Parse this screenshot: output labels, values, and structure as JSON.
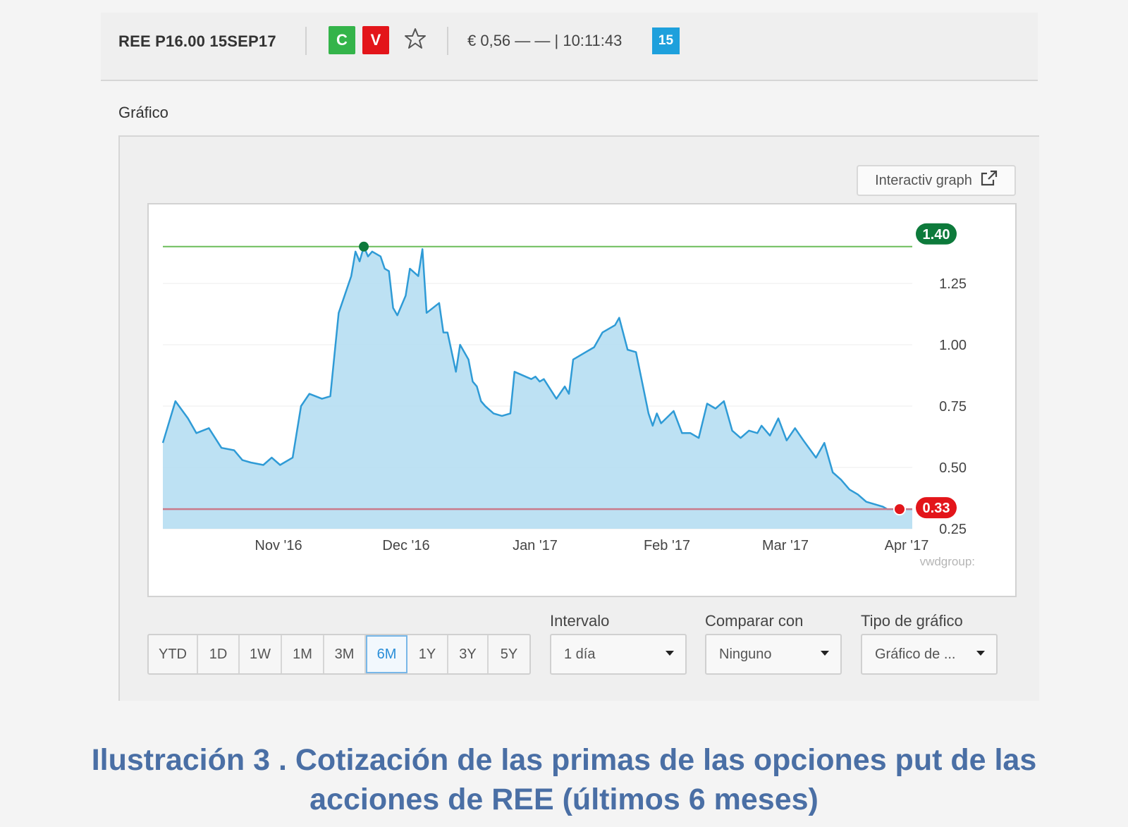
{
  "topbar": {
    "instrument": "REE P16.00 15SEP17",
    "buy_label": "C",
    "sell_label": "V",
    "quote": "€ 0,56 — — | 10:11:43",
    "delay_badge": "15",
    "icons": {
      "favorite": "star-outline-icon"
    }
  },
  "section_title": "Gráfico",
  "interactive_graph": {
    "label": "Interactiv graph",
    "icon": "external-link-icon"
  },
  "chart_data": {
    "type": "area",
    "x_ticks": [
      "Nov '16",
      "Dec '16",
      "Jan '17",
      "Feb '17",
      "Mar '17",
      "Apr '17"
    ],
    "y_ticks": [
      "1.25",
      "1.00",
      "0.75",
      "0.50",
      "0.25"
    ],
    "ylim": [
      0.25,
      1.5
    ],
    "grid": true,
    "high_label": "1.40",
    "low_label": "0.33",
    "high_value": 1.4,
    "low_value": 0.33,
    "watermark": "vwdgroup:",
    "colors": {
      "line": "#2f9bd6",
      "fill": "#b9dff2",
      "high": "#0d7a3b",
      "low": "#e3151a"
    },
    "series": [
      {
        "x": [
          "2016-10-07",
          "2016-10-10",
          "2016-10-13",
          "2016-10-15",
          "2016-10-18",
          "2016-10-21",
          "2016-10-24",
          "2016-10-26",
          "2016-10-28",
          "2016-10-31",
          "2016-11-02",
          "2016-11-04",
          "2016-11-07",
          "2016-11-09",
          "2016-11-11",
          "2016-11-14",
          "2016-11-16",
          "2016-11-18",
          "2016-11-21",
          "2016-11-22",
          "2016-11-23",
          "2016-11-24",
          "2016-11-25",
          "2016-11-26",
          "2016-11-28",
          "2016-11-29",
          "2016-11-30",
          "2016-12-01",
          "2016-12-02",
          "2016-12-04",
          "2016-12-05",
          "2016-12-07",
          "2016-12-08",
          "2016-12-09",
          "2016-12-12",
          "2016-12-13",
          "2016-12-14",
          "2016-12-16",
          "2016-12-17",
          "2016-12-19",
          "2016-12-20",
          "2016-12-21",
          "2016-12-22",
          "2016-12-23",
          "2016-12-25",
          "2016-12-27",
          "2016-12-29",
          "2016-12-30",
          "2017-01-03",
          "2017-01-04",
          "2017-01-05",
          "2017-01-06",
          "2017-01-09",
          "2017-01-11",
          "2017-01-12",
          "2017-01-13",
          "2017-01-16",
          "2017-01-18",
          "2017-01-20",
          "2017-01-23",
          "2017-01-24",
          "2017-01-26",
          "2017-01-28",
          "2017-01-31",
          "2017-02-01",
          "2017-02-02",
          "2017-02-03",
          "2017-02-06",
          "2017-02-08",
          "2017-02-10",
          "2017-02-12",
          "2017-02-14",
          "2017-02-16",
          "2017-02-18",
          "2017-02-20",
          "2017-02-22",
          "2017-02-24",
          "2017-02-26",
          "2017-02-27",
          "2017-03-01",
          "2017-03-03",
          "2017-03-05",
          "2017-03-07",
          "2017-03-09",
          "2017-03-12",
          "2017-03-14",
          "2017-03-16",
          "2017-03-18",
          "2017-03-20",
          "2017-03-22",
          "2017-03-24",
          "2017-03-26",
          "2017-03-28",
          "2017-03-29",
          "2017-03-30",
          "2017-03-31",
          "2017-04-01",
          "2017-04-03",
          "2017-04-04"
        ],
        "values": [
          0.6,
          0.77,
          0.7,
          0.64,
          0.66,
          0.58,
          0.57,
          0.53,
          0.52,
          0.51,
          0.54,
          0.51,
          0.54,
          0.75,
          0.8,
          0.78,
          0.79,
          1.13,
          1.28,
          1.38,
          1.34,
          1.4,
          1.36,
          1.38,
          1.36,
          1.31,
          1.3,
          1.15,
          1.12,
          1.2,
          1.31,
          1.28,
          1.39,
          1.13,
          1.17,
          1.05,
          1.05,
          0.89,
          1.0,
          0.94,
          0.85,
          0.83,
          0.77,
          0.75,
          0.72,
          0.71,
          0.72,
          0.89,
          0.86,
          0.87,
          0.85,
          0.86,
          0.78,
          0.83,
          0.8,
          0.94,
          0.97,
          0.99,
          1.05,
          1.08,
          1.11,
          0.98,
          0.97,
          0.72,
          0.67,
          0.72,
          0.68,
          0.73,
          0.64,
          0.64,
          0.62,
          0.76,
          0.74,
          0.77,
          0.65,
          0.62,
          0.65,
          0.64,
          0.67,
          0.63,
          0.7,
          0.61,
          0.66,
          0.61,
          0.54,
          0.6,
          0.48,
          0.45,
          0.41,
          0.39,
          0.36,
          0.35,
          0.34,
          0.33,
          0.33,
          0.33,
          0.33,
          0.33,
          0.33
        ]
      }
    ]
  },
  "ranges": [
    "YTD",
    "1D",
    "1W",
    "1M",
    "3M",
    "6M",
    "1Y",
    "3Y",
    "5Y"
  ],
  "active_range": "6M",
  "interval": {
    "label": "Intervalo",
    "value": "1 día"
  },
  "compare": {
    "label": "Comparar con",
    "value": "Ninguno"
  },
  "chart_type": {
    "label": "Tipo de gráfico",
    "value": "Gráfico de ..."
  },
  "caption": {
    "line1": "Ilustración 3 . Cotización de las primas de las opciones put de las",
    "line2": "acciones de REE (últimos 6 meses)"
  }
}
